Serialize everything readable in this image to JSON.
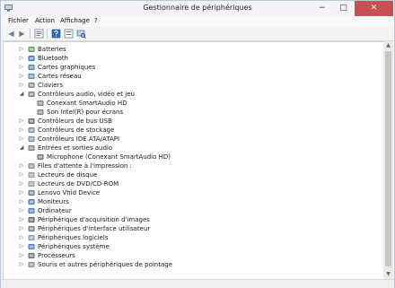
{
  "window": {
    "title": "Gestionnaire de périphériques"
  },
  "menu": [
    "Fichier",
    "Action",
    "Affichage",
    "?"
  ],
  "toolbar": [
    "back-icon",
    "forward-icon",
    "properties-icon",
    "help-icon",
    "scan-hardware-icon"
  ],
  "tree": {
    "items": [
      {
        "label": "Batteries",
        "level": 0,
        "expanded": false,
        "icon": "battery-icon"
      },
      {
        "label": "Bluetooth",
        "level": 0,
        "expanded": false,
        "icon": "bluetooth-icon"
      },
      {
        "label": "Cartes graphiques",
        "level": 0,
        "expanded": false,
        "icon": "display-adapter-icon"
      },
      {
        "label": "Cartes réseau",
        "level": 0,
        "expanded": false,
        "icon": "network-adapter-icon"
      },
      {
        "label": "Claviers",
        "level": 0,
        "expanded": false,
        "icon": "keyboard-icon"
      },
      {
        "label": "Contrôleurs audio, vidéo et jeu",
        "level": 0,
        "expanded": true,
        "icon": "speaker-icon"
      },
      {
        "label": "Conexant SmartAudio HD",
        "level": 1,
        "expanded": null,
        "icon": "speaker-icon"
      },
      {
        "label": "Son Intel(R) pour écrans",
        "level": 1,
        "expanded": null,
        "icon": "speaker-icon"
      },
      {
        "label": "Contrôleurs de bus USB",
        "level": 0,
        "expanded": false,
        "icon": "usb-icon"
      },
      {
        "label": "Contrôleurs de stockage",
        "level": 0,
        "expanded": false,
        "icon": "storage-controller-icon"
      },
      {
        "label": "Contrôleurs IDE ATA/ATAPI",
        "level": 0,
        "expanded": false,
        "icon": "ide-controller-icon"
      },
      {
        "label": "Entrées et sorties audio",
        "level": 0,
        "expanded": true,
        "icon": "audio-io-icon"
      },
      {
        "label": "Microphone (Conexant SmartAudio HD)",
        "level": 1,
        "expanded": null,
        "icon": "microphone-icon"
      },
      {
        "label": "Files d'attente à l'impression :",
        "level": 0,
        "expanded": false,
        "icon": "print-queue-icon"
      },
      {
        "label": "Lecteurs de disque",
        "level": 0,
        "expanded": false,
        "icon": "disk-drive-icon"
      },
      {
        "label": "Lecteurs de DVD/CD-ROM",
        "level": 0,
        "expanded": false,
        "icon": "dvd-drive-icon"
      },
      {
        "label": "Lenovo Vhid Device",
        "level": 0,
        "expanded": false,
        "icon": "hid-device-icon"
      },
      {
        "label": "Moniteurs",
        "level": 0,
        "expanded": false,
        "icon": "monitor-icon"
      },
      {
        "label": "Ordinateur",
        "level": 0,
        "expanded": false,
        "icon": "computer-icon"
      },
      {
        "label": "Périphérique d'acquisition d'images",
        "level": 0,
        "expanded": false,
        "icon": "camera-icon"
      },
      {
        "label": "Périphériques d'interface utilisateur",
        "level": 0,
        "expanded": false,
        "icon": "hid-icon"
      },
      {
        "label": "Périphériques logiciels",
        "level": 0,
        "expanded": false,
        "icon": "software-device-icon"
      },
      {
        "label": "Périphériques système",
        "level": 0,
        "expanded": false,
        "icon": "system-device-icon"
      },
      {
        "label": "Processeurs",
        "level": 0,
        "expanded": false,
        "icon": "processor-icon"
      },
      {
        "label": "Souris et autres périphériques de pointage",
        "level": 0,
        "expanded": false,
        "icon": "mouse-icon"
      }
    ]
  },
  "colors": {
    "close_button": "#c75050",
    "tree_background": "#ffffff"
  }
}
